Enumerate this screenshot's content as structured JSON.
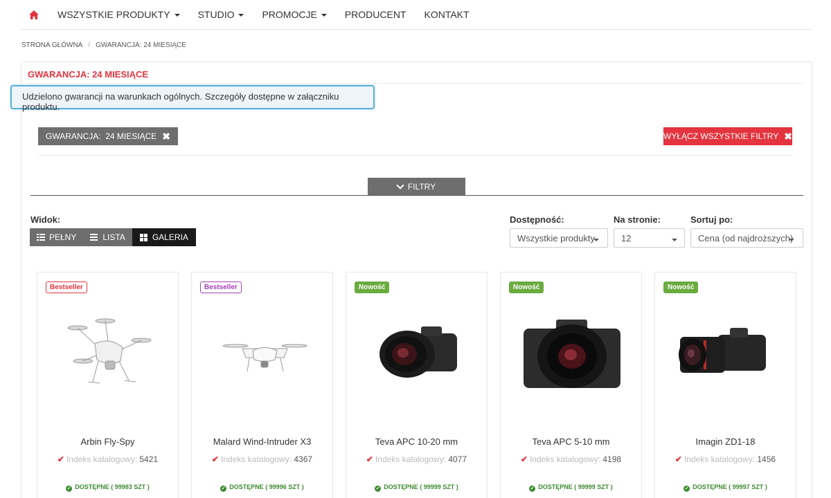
{
  "nav": {
    "items": [
      {
        "label": "WSZYSTKIE PRODUKTY",
        "dropdown": true
      },
      {
        "label": "STUDIO",
        "dropdown": true
      },
      {
        "label": "PROMOCJE",
        "dropdown": true
      },
      {
        "label": "PRODUCENT",
        "dropdown": false
      },
      {
        "label": "KONTAKT",
        "dropdown": false
      }
    ],
    "home_icon": "home-icon",
    "accent_color": "#e3343f"
  },
  "breadcrumb": {
    "items": [
      "STRONA GŁÓWNA",
      "GWARANCJA: 24 MIESIĄCE"
    ],
    "separator": "/"
  },
  "page": {
    "title": "GWARANCJA: 24 MIESIĄCE",
    "tooltip": "Udzielono gwarancji na warunkach ogólnych. Szczegóły dostępne w załączniku produktu."
  },
  "active_filters": {
    "chip": "GWARANCJA:  24 MIESIĄCE",
    "clear_all": "WYŁĄCZ WSZYSTKIE FILTRY"
  },
  "filters_toggle": "FILTRY",
  "view": {
    "label": "Widok:",
    "options": [
      "PEŁNY",
      "LISTA",
      "GALERIA"
    ],
    "selected": "GALERIA"
  },
  "availability": {
    "label": "Dostępność:",
    "value": "Wszystkie produkty"
  },
  "per_page": {
    "label": "Na stronie:",
    "value": "12"
  },
  "sort": {
    "label": "Sortuj po:",
    "value": "Cena (od najdroższych)"
  },
  "products": [
    {
      "badge": "Bestseller",
      "name": "Arbin Fly-Spy",
      "index_label": "Indeks katalogowy:",
      "index": "5421",
      "stock": "DOSTĘPNE ( 99983 SZT )",
      "image": "drone"
    },
    {
      "badge": "Bestseller",
      "name": "Malard Wind-Intruder X3",
      "index_label": "Indeks katalogowy:",
      "index": "4367",
      "stock": "DOSTĘPNE ( 99996 SZT )",
      "image": "drone"
    },
    {
      "badge": "Nowość",
      "name": "Teva APC 10-20 mm",
      "index_label": "Indeks katalogowy:",
      "index": "4077",
      "stock": "DOSTĘPNE ( 99999 SZT )",
      "image": "camera"
    },
    {
      "badge": "Nowość",
      "name": "Teva APC 5-10 mm",
      "index_label": "Indeks katalogowy:",
      "index": "4198",
      "stock": "DOSTĘPNE ( 99999 SZT )",
      "image": "camera"
    },
    {
      "badge": "Nowość",
      "name": "Imagin ZD1-18",
      "index_label": "Indeks katalogowy:",
      "index": "1456",
      "stock": "DOSTĘPNE ( 99997 SZT )",
      "image": "camera"
    }
  ]
}
